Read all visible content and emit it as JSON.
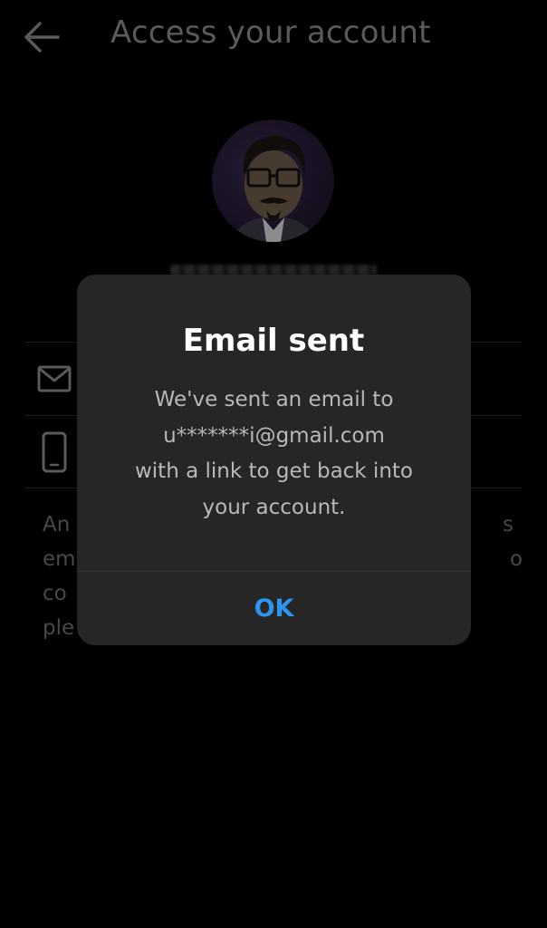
{
  "header": {
    "title": "Access your account",
    "back_icon": "back-arrow-icon"
  },
  "profile": {
    "avatar_icon": "profile-avatar"
  },
  "options": [
    {
      "icon": "mail-icon"
    },
    {
      "icon": "phone-icon"
    }
  ],
  "background_text": {
    "lines": [
      "An",
      "em",
      "co",
      "ple"
    ],
    "right_fragments": [
      "s",
      "o"
    ]
  },
  "dialog": {
    "title": "Email sent",
    "body_lines": [
      "We've sent an email to",
      "u*******i@gmail.com",
      "with a link to get back into",
      "your account."
    ],
    "ok_label": "OK"
  },
  "colors": {
    "background": "#000000",
    "dialog_bg": "#262626",
    "accent": "#2d95f0",
    "title_text": "#ffffff",
    "body_text": "#b8b8b8"
  }
}
